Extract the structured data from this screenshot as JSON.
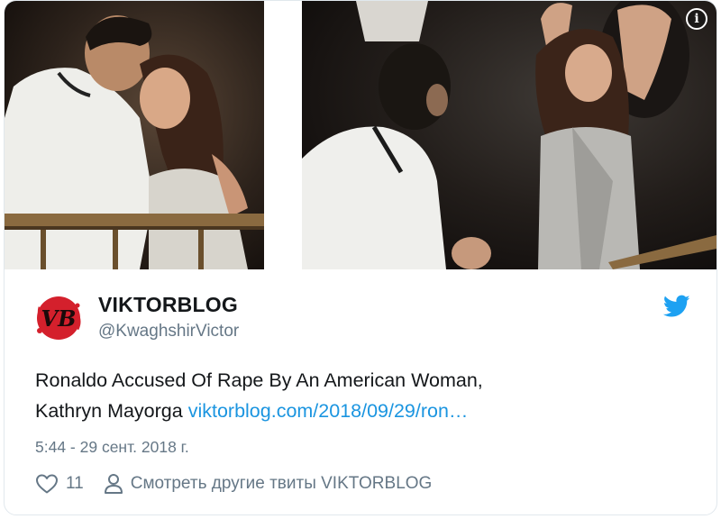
{
  "tweet": {
    "display_name": "VIKTORBLOG",
    "handle": "@KwaghshirVictor",
    "avatar_letters": "VB",
    "text_line1": "Ronaldo Accused Of Rape By An American Woman,",
    "text_line2_prefix": "Kathryn Mayorga ",
    "link_text": "viktorblog.com/2018/09/29/ron…",
    "timestamp": "5:44 - 29 сент. 2018 г.",
    "like_count": "11",
    "more_tweets_label": "Смотреть другие твиты VIKTORBLOG"
  },
  "media": {
    "info_icon_glyph": "i"
  },
  "icons": {
    "info": "info-icon",
    "twitter_logo": "twitter-bird-icon",
    "like": "heart-icon",
    "person": "person-icon"
  },
  "colors": {
    "link": "#1b95e0",
    "twitter_blue": "#1da1f2",
    "secondary_text": "#657786",
    "avatar_red": "#d4202c"
  }
}
